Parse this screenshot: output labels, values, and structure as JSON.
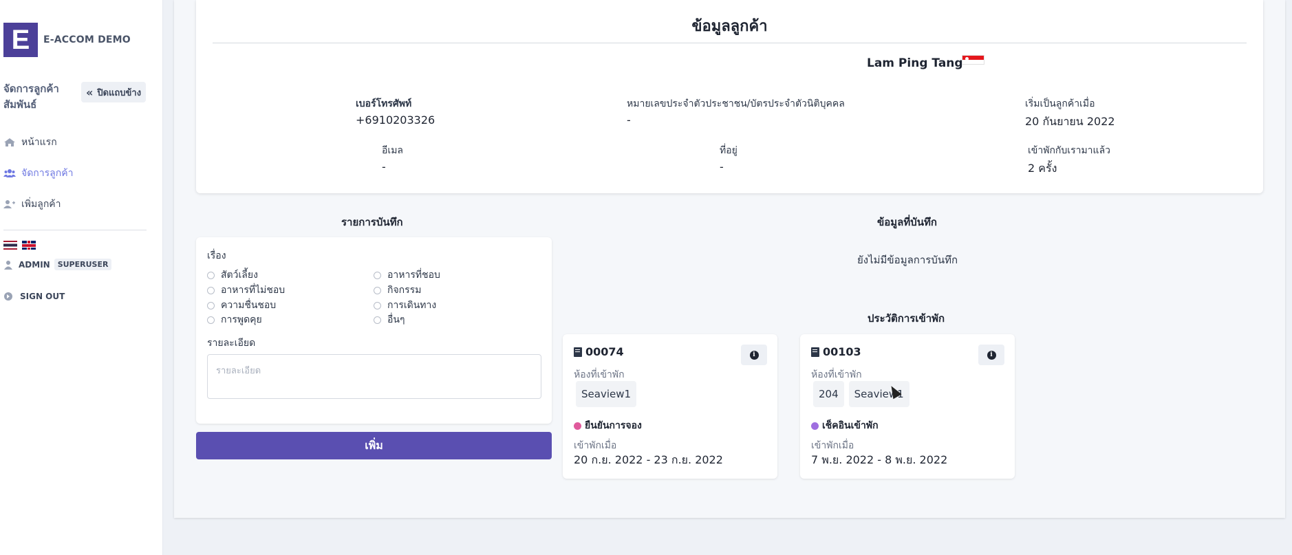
{
  "sidebar": {
    "logo_letter": "E",
    "brand": "E-ACCOM DEMO",
    "section_title": "จัดการลูกค้าสัมพันธ์",
    "collapse_label": "ปิดแถบข้าง",
    "nav": [
      {
        "label": "หน้าแรก",
        "icon": "home-icon",
        "active": false
      },
      {
        "label": "จัดการลูกค้า",
        "icon": "users-icon",
        "active": true
      },
      {
        "label": "เพิ่มลูกค้า",
        "icon": "user-plus-icon",
        "active": false
      }
    ],
    "user": "ADMIN",
    "role": "SUPERUSER",
    "signout": "SIGN OUT"
  },
  "customer": {
    "title": "ข้อมูลลูกค้า",
    "name": "Lam Ping Tang",
    "phone_label": "เบอร์โทรศัพท์",
    "phone": "+6910203326",
    "id_label": "หมายเลขประจำตัวประชาชน/บัตรประจำตัวนิติบุคคล",
    "id_value": "-",
    "since_label": "เริ่มเป็นลูกค้าเมื่อ",
    "since": "20 กันยายน 2022",
    "email_label": "อีเมล",
    "email": "-",
    "address_label": "ที่อยู่",
    "address": "-",
    "stays_label": "เข้าพักกับเรามาแล้ว",
    "stays": "2 ครั้ง"
  },
  "notes": {
    "title": "รายการบันทึก",
    "topic_label": "เรื่อง",
    "topics": [
      "สัตว์เลี้ยง",
      "อาหารที่ชอบ",
      "อาหารที่ไม่ชอบ",
      "กิจกรรม",
      "ความชื่นชอบ",
      "การเดินทาง",
      "การพูดคุย",
      "อื่นๆ"
    ],
    "detail_label": "รายละเอียด",
    "detail_placeholder": "รายละเอียด",
    "add_button": "เพิ่ม"
  },
  "saved": {
    "title": "ข้อมูลที่บันทึก",
    "empty": "ยังไม่มีข้อมูลการบันทึก"
  },
  "history": {
    "title": "ประวัติการเข้าพัก",
    "room_label": "ห้องที่เข้าพัก",
    "date_label": "เข้าพักเมื่อ",
    "stays": [
      {
        "code": "00074",
        "rooms": [
          "Seaview1"
        ],
        "status": "ยืนยันการจอง",
        "status_color": "#e05a9c",
        "dates": "20 ก.ย. 2022 - 23 ก.ย. 2022"
      },
      {
        "code": "00103",
        "rooms": [
          "204",
          "Seaview1"
        ],
        "status": "เช็คอินเข้าพัก",
        "status_color": "#9f6fe0",
        "dates": "7 พ.ย. 2022 - 8 พ.ย. 2022"
      }
    ]
  }
}
